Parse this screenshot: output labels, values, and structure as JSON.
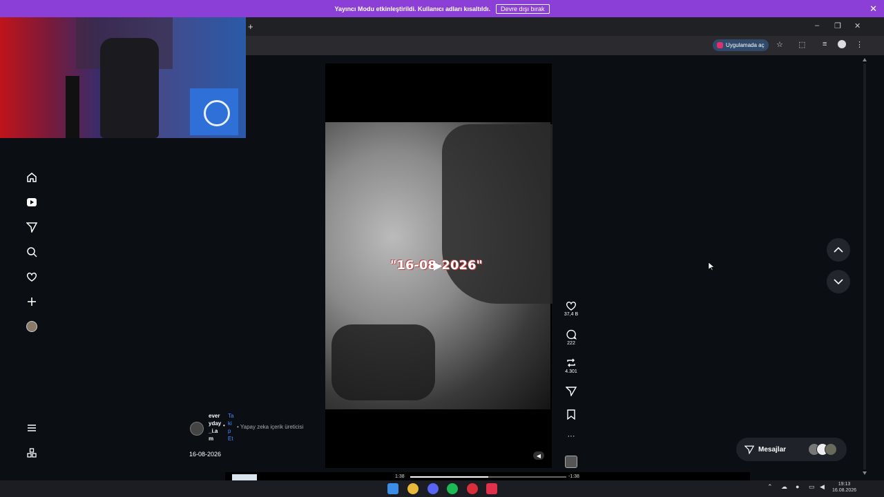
{
  "banner": {
    "message": "Yayıncı Modu etkinleştirildi. Kullanıcı adları kısaltıldı.",
    "disable_button": "Devre dışı bırak",
    "close": "✕"
  },
  "browser": {
    "new_tab": "+",
    "minimize": "–",
    "restore": "❐",
    "close": "✕",
    "open_in_app": "Uygulamada aç"
  },
  "post": {
    "overlay_text": "\"16-08-2026\"",
    "username": "everyday_i.am",
    "username_display": "ever\nyday\n_i.a\nm",
    "follow": "Ta\nki\np\nEt",
    "ai_label": "• Yapay zeka içerik üreticisi",
    "caption": "16-08-2026"
  },
  "actions": {
    "likes": "37,4 B",
    "comments": "222",
    "reposts": "4.301"
  },
  "player": {
    "time_elapsed": "1:38",
    "time_remaining": "-1:38",
    "progress": 0.5
  },
  "messages": {
    "label": "Mesajlar"
  },
  "taskbar": {
    "time": "19:13",
    "date": "16.08.2026"
  },
  "colors": {
    "banner": "#8c3fd6",
    "background": "#0b0e12",
    "follow": "#4a8cff"
  }
}
